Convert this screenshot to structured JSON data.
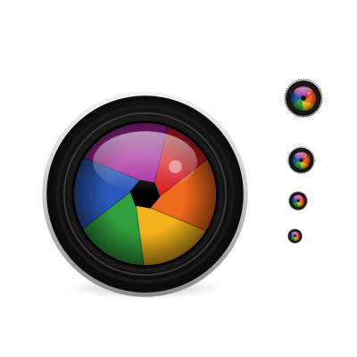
{
  "icon_set": {
    "subject": "camera-lens-icon",
    "variants": [
      "large",
      "medium",
      "small",
      "xsmall",
      "tiny"
    ]
  },
  "colors": {
    "background": "#ffffff",
    "bezel_silver_light": "#f2f2f2",
    "bezel_silver_dark": "#8a8a8a",
    "barrel_black": "#0b0b0b",
    "barrel_dark_gray": "#2a2a2a",
    "knurl_gray": "#4a4a4a",
    "aperture_center": "#000000"
  },
  "aperture_blades": [
    {
      "name": "red",
      "color": "#d61f26"
    },
    {
      "name": "orange",
      "color": "#ef6a1c"
    },
    {
      "name": "yellow",
      "color": "#f2b21b"
    },
    {
      "name": "green",
      "color": "#2f9e3c"
    },
    {
      "name": "blue",
      "color": "#2a57b8"
    },
    {
      "name": "magenta",
      "color": "#a8279f"
    }
  ]
}
